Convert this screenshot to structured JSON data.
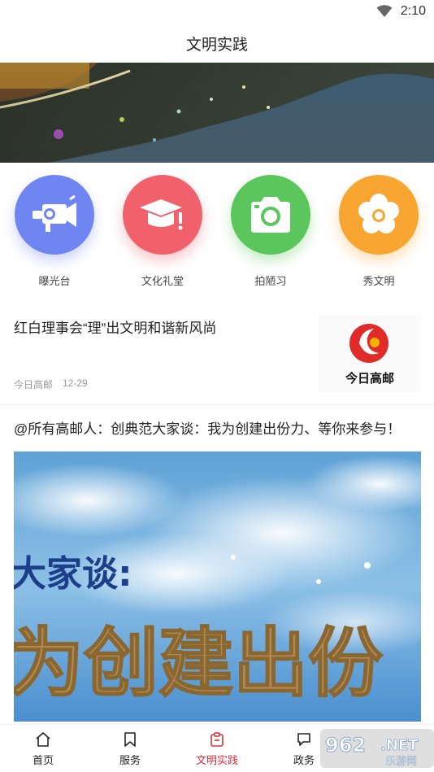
{
  "status_bar": {
    "time": "2:10"
  },
  "header": {
    "title": "文明实践"
  },
  "quick_entries": [
    {
      "label": "曝光台",
      "icon": "video-camera-icon",
      "color": "#6f86f2"
    },
    {
      "label": "文化礼堂",
      "icon": "graduation-cap-icon",
      "color": "#f0616c"
    },
    {
      "label": "拍陋习",
      "icon": "camera-icon",
      "color": "#5bc65b"
    },
    {
      "label": "秀文明",
      "icon": "flower-icon",
      "color": "#f8a531"
    }
  ],
  "articles": [
    {
      "title": "红白理事会“理”出文明和谐新风尚",
      "source": "今日高邮",
      "date": "12-29",
      "thumb_text": "今日高邮"
    },
    {
      "title": "@所有高邮人：创典范大家谈：我为创建出份力、等你来参与！",
      "image_text_line1": "大家谈:",
      "image_text_line2": "为创建出份"
    }
  ],
  "tab_bar": {
    "items": [
      {
        "label": "首页",
        "icon": "home-icon"
      },
      {
        "label": "服务",
        "icon": "bookmark-icon"
      },
      {
        "label": "文明实践",
        "icon": "clipboard-icon",
        "active": true
      },
      {
        "label": "政务",
        "icon": "chat-icon"
      }
    ]
  },
  "watermark": {
    "text1": "962",
    "text2": ".NET",
    "text3": "乐游网"
  }
}
